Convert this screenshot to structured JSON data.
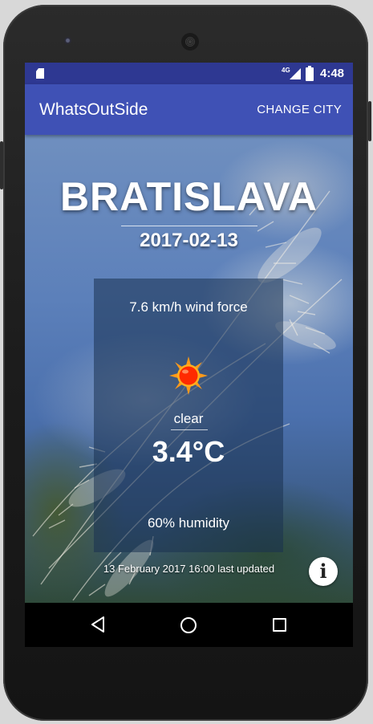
{
  "status_bar": {
    "network": "4G",
    "time": "4:48"
  },
  "app_bar": {
    "title": "WhatsOutSide",
    "action_label": "CHANGE CITY"
  },
  "weather": {
    "city": "BRATISLAVA",
    "date": "2017-02-13",
    "wind": "7.6 km/h wind force",
    "condition": "clear",
    "condition_icon": "sun-icon",
    "temperature": "3.4°C",
    "humidity": "60% humidity",
    "last_updated": "13 February 2017 16:00 last updated"
  },
  "info_button": {
    "glyph": "i"
  },
  "nav_bar": {
    "icons": [
      "back-icon",
      "home-icon",
      "recents-icon"
    ]
  },
  "colors": {
    "status_bar": "#2e3892",
    "app_bar": "#3f51b5",
    "sun": "#ff2a00",
    "sun_rays": "#ff9a1a"
  }
}
